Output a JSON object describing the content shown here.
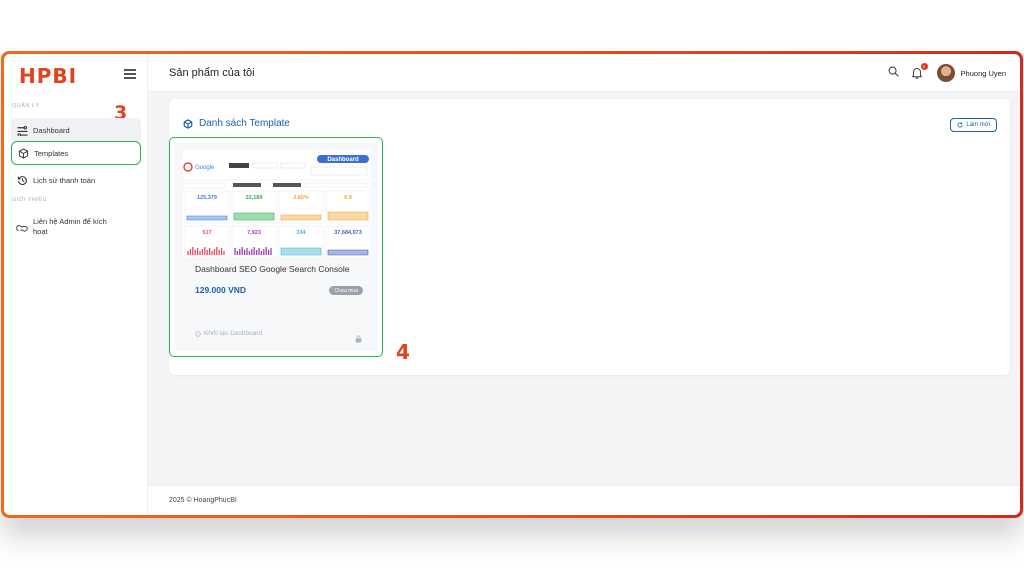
{
  "brand": {
    "logo": "HPBI",
    "accent": "#e2421c"
  },
  "sidebar": {
    "section_manage": "QUẢN LÝ",
    "section_intro": "GIỚI THIỆU",
    "items": [
      {
        "label": "Dashboard",
        "icon": "dashboard-icon"
      },
      {
        "label": "Templates",
        "icon": "box-icon"
      },
      {
        "label": "Lịch sử thanh toán",
        "icon": "history-icon"
      },
      {
        "label": "Liên hệ Admin để kích hoạt",
        "icon": "handshake-icon"
      }
    ],
    "step_marker": "3"
  },
  "header": {
    "title": "Sản phẩm của tôi",
    "notification_count": "0",
    "user_name": "Phuong Uyen"
  },
  "main": {
    "section_title": "Danh sách Template",
    "refresh_label": "Làm mới",
    "step_marker": "4",
    "template": {
      "name": "Dashboard SEO Google Search Console",
      "price": "129.000 VND",
      "status": "Chưa mua",
      "action": "Khởi tạo Dashboard",
      "thumb": {
        "tag": "Dashboard",
        "metrics": [
          "125,379",
          "22,189",
          "3.85%",
          "9.9",
          "517",
          "7,923",
          "334",
          "37,684,073"
        ],
        "colors": [
          "#3b7fe0",
          "#2fae55",
          "#f0a93c",
          "#f0a93c",
          "#e84a5f",
          "#9c3fb5",
          "#3fb6d8",
          "#3b5fbe"
        ]
      }
    }
  },
  "footer": {
    "text": "2025 © HoangPhucBI"
  }
}
